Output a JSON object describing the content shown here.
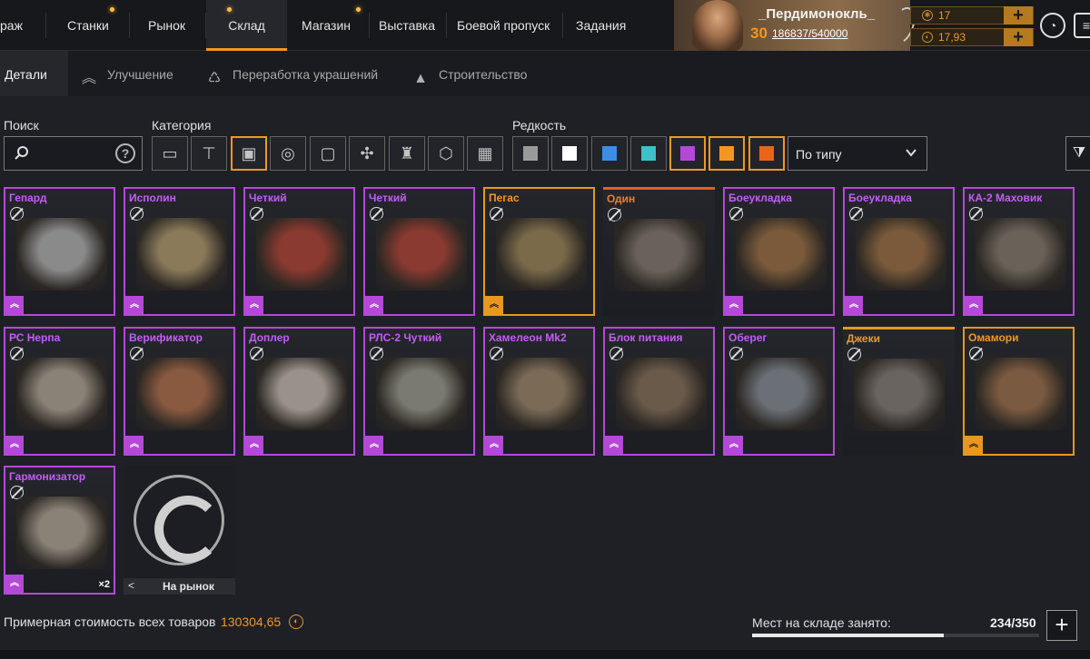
{
  "nav": {
    "items": [
      "раж",
      "Станки",
      "Рынок",
      "Склад",
      "Магазин",
      "Выставка",
      "Боевой пропуск",
      "Задания"
    ],
    "active": "Склад"
  },
  "profile": {
    "name": "_Пердимонокль_",
    "level": "30",
    "xp": "186837/540000",
    "currency1": "17",
    "currency2": "17,93"
  },
  "subtabs": [
    "Детали",
    "Улучшение",
    "Переработка украшений",
    "Строительство"
  ],
  "filters": {
    "search_label": "Поиск",
    "category_label": "Категория",
    "rarity_label": "Редкость",
    "rarity_colors": [
      "#9a9a9a",
      "#ffffff",
      "#3a8ee6",
      "#3ec0c8",
      "#b548d9",
      "#f19722",
      "#e8651a"
    ],
    "sort": "По типу"
  },
  "items": [
    {
      "name": "Гепард",
      "rarity": "epic",
      "color": "#8a8a8a"
    },
    {
      "name": "Исполин",
      "rarity": "epic",
      "color": "#8a7a5a"
    },
    {
      "name": "Четкий",
      "rarity": "epic",
      "color": "#8a3a30"
    },
    {
      "name": "Четкий",
      "rarity": "epic",
      "color": "#8a3a30"
    },
    {
      "name": "Пегас",
      "rarity": "legendary",
      "color": "#7a6a4a"
    },
    {
      "name": "Один",
      "rarity": "relic",
      "color": "#6a625a"
    },
    {
      "name": "Боеукладка",
      "rarity": "epic",
      "color": "#7a5a3a"
    },
    {
      "name": "Боеукладка",
      "rarity": "epic",
      "color": "#7a5a3a"
    },
    {
      "name": "КА-2 Маховик",
      "rarity": "epic",
      "color": "#6a6258"
    },
    {
      "name": "РС Нерпа",
      "rarity": "epic",
      "color": "#8a8276"
    },
    {
      "name": "Верификатор",
      "rarity": "epic",
      "color": "#8a5a40"
    },
    {
      "name": "Доплер",
      "rarity": "epic",
      "color": "#9a928a"
    },
    {
      "name": "РЛС-2 Чуткий",
      "rarity": "epic",
      "color": "#7a7a70"
    },
    {
      "name": "Хамелеон Mk2",
      "rarity": "epic",
      "color": "#7a6a56"
    },
    {
      "name": "Блок питания",
      "rarity": "epic",
      "color": "#6a5a4a"
    },
    {
      "name": "Оберег",
      "rarity": "epic",
      "color": "#6a7076"
    },
    {
      "name": "Джеки",
      "rarity": "legendary",
      "color": "#6a6460"
    },
    {
      "name": "Омамори",
      "rarity": "legendary",
      "color": "#7a5a40"
    },
    {
      "name": "Гармонизатор",
      "rarity": "epic",
      "color": "#8a8276",
      "qty": "×2"
    }
  ],
  "market_card": {
    "back": "<",
    "label": "На рынок"
  },
  "footer": {
    "total_label": "Примерная стоимость всех товаров",
    "total_value": "130304,65",
    "storage_label": "Мест на складе занято:",
    "storage_count": "234/350",
    "storage_used": 234,
    "storage_max": 350
  }
}
